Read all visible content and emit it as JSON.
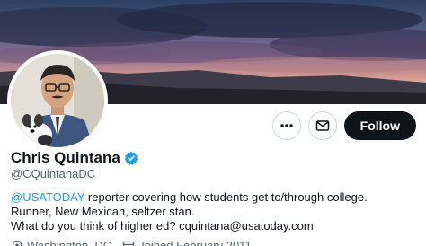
{
  "profile": {
    "display_name": "Chris Quintana",
    "handle": "@CQuintanaDC",
    "verified": true
  },
  "bio": {
    "mention": "@USATODAY",
    "line1_rest": " reporter covering how students get to/through college.",
    "line2": "Runner, New Mexican, seltzer stan.",
    "line3": "What do you think of higher ed? cquintana@usatoday.com"
  },
  "meta": {
    "location": "Washington, DC",
    "joined": "Joined February 2011"
  },
  "actions": {
    "more_icon": "more-horizontal-icon",
    "message_icon": "envelope-icon",
    "follow_label": "Follow"
  },
  "colors": {
    "accent": "#1d9bf0",
    "primary_text": "#0f1419",
    "secondary_text": "#536471",
    "follow_bg": "#0f1419"
  }
}
